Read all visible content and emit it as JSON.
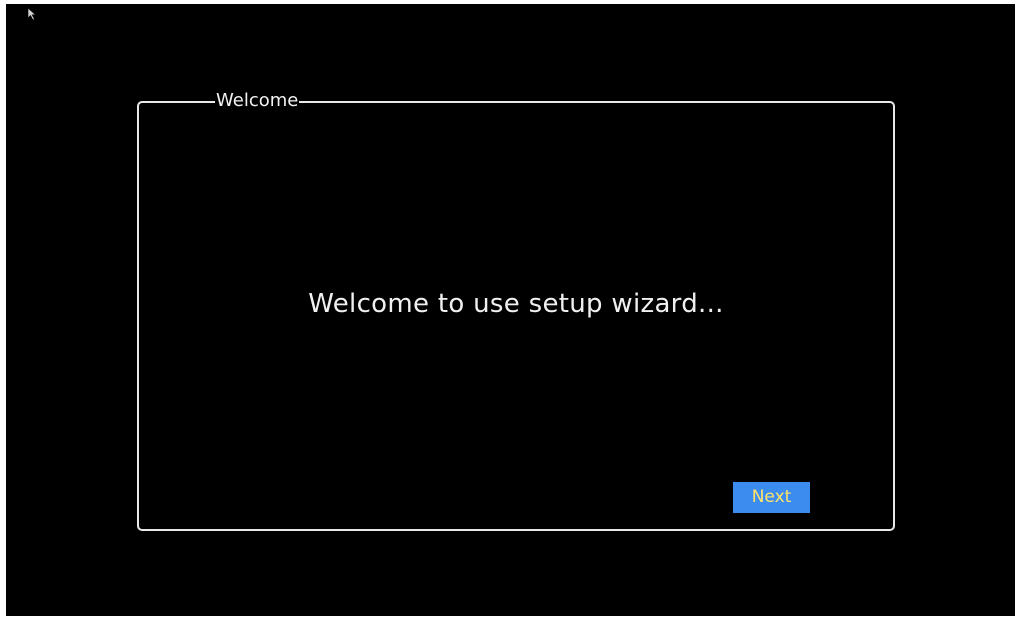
{
  "wizard": {
    "panel_title": "Welcome",
    "message": "Welcome to use setup wizard...",
    "next_label": "Next"
  },
  "colors": {
    "background": "#000000",
    "border": "#e8e8e8",
    "text": "#f0f0f0",
    "button_bg": "#3c8cf0",
    "button_text": "#ffe36a"
  },
  "icons": {
    "cursor": "mouse-pointer-icon"
  }
}
